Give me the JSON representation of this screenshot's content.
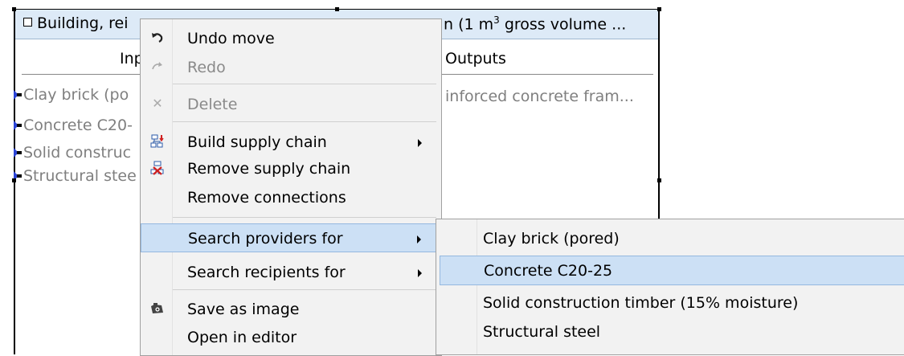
{
  "process": {
    "title_left": "Building, rei",
    "title_right_prefix": "n (1 m",
    "title_right_sup": "3",
    "title_right_suffix": " gross volume ...",
    "inputs_header": "Inp",
    "outputs_header": "Outputs",
    "inputs": [
      "Clay brick (po",
      "Concrete C20-",
      "Solid construc",
      "Structural stee"
    ],
    "output": "inforced concrete fram..."
  },
  "context_menu": {
    "items": [
      {
        "label": "Undo move",
        "icon": "undo-icon",
        "disabled": false
      },
      {
        "label": "Redo",
        "icon": "redo-icon",
        "disabled": true
      },
      {
        "label": "Delete",
        "icon": "delete-icon",
        "disabled": true
      },
      {
        "label": "Build supply chain",
        "icon": "build-supply-chain-icon",
        "submenu": true
      },
      {
        "label": "Remove supply chain",
        "icon": "remove-supply-chain-icon"
      },
      {
        "label": "Remove connections"
      },
      {
        "label": "Search providers for",
        "submenu": true,
        "highlighted": true
      },
      {
        "label": "Search recipients for",
        "submenu": true
      },
      {
        "label": "Save as image",
        "icon": "camera-icon"
      },
      {
        "label": "Open in editor"
      }
    ]
  },
  "submenu": {
    "items": [
      {
        "label": "Clay brick (pored)"
      },
      {
        "label": "Concrete C20-25",
        "highlighted": true
      },
      {
        "label": "Solid construction timber (15% moisture)"
      },
      {
        "label": "Structural steel"
      }
    ]
  },
  "colors": {
    "highlight": "#cce0f5",
    "header": "#ddeaf7",
    "port": "#2b44d6"
  }
}
